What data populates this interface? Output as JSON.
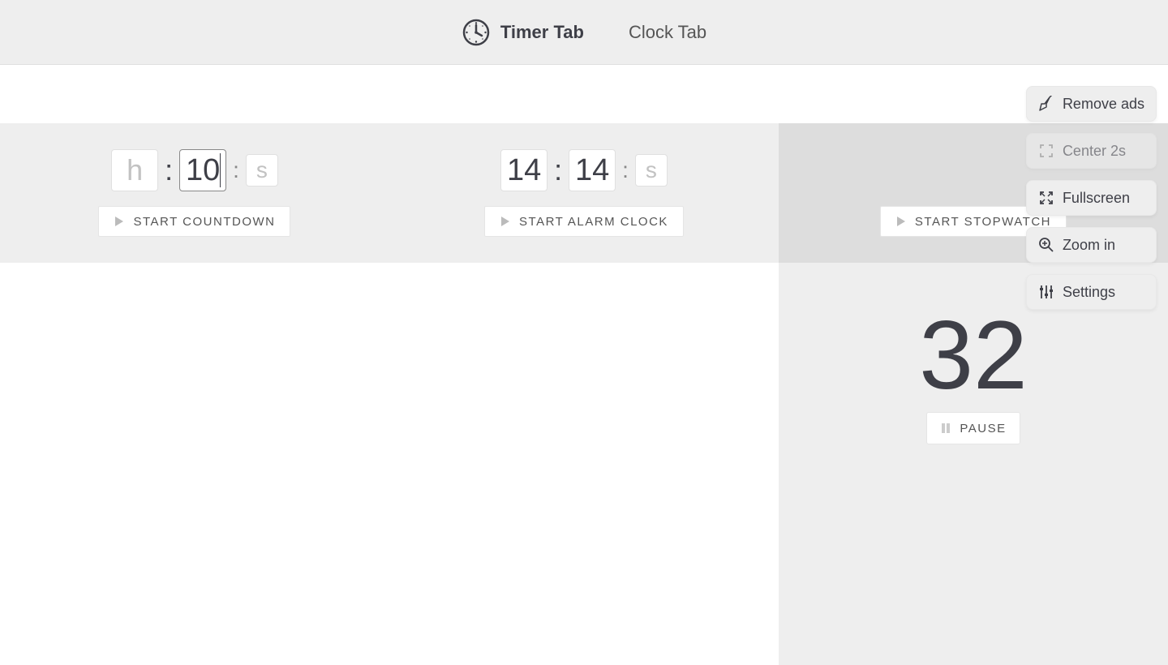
{
  "header": {
    "tabs": [
      {
        "label": "Timer Tab",
        "active": true
      },
      {
        "label": "Clock Tab",
        "active": false
      }
    ]
  },
  "countdown": {
    "hours": "",
    "hours_placeholder": "h",
    "minutes": "10",
    "seconds": "",
    "seconds_placeholder": "s",
    "start_label": "START  COUNTDOWN"
  },
  "alarm": {
    "hours": "14",
    "minutes": "14",
    "seconds_placeholder": "s",
    "start_label": "START  ALARM CLOCK"
  },
  "stopwatch": {
    "start_label": "START  STOPWATCH",
    "elapsed": "32",
    "pause_label": "PAUSE"
  },
  "toolbar": {
    "remove_ads": "Remove ads",
    "center": "Center 2s",
    "fullscreen": "Fullscreen",
    "zoom": "Zoom in",
    "settings": "Settings"
  }
}
